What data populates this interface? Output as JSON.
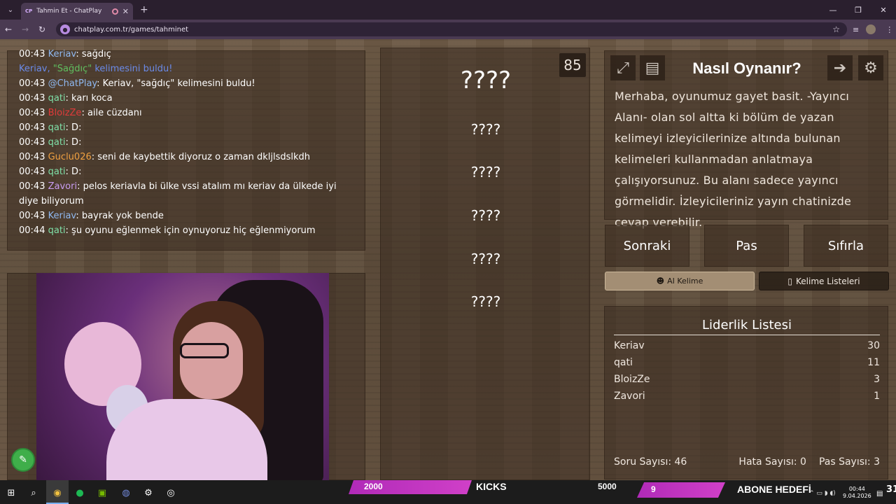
{
  "browser": {
    "tab_title": "Tahmin Et - ChatPlay",
    "tab_favicon": "CP",
    "url": "chatplay.com.tr/games/tahminet"
  },
  "chat": {
    "lines": [
      {
        "time": "00:43",
        "user": "Keriav",
        "color": "blue",
        "text": ": sağdıç"
      },
      {
        "system": true,
        "pre": "Keriav, ",
        "word": "\"Sağdıç\"",
        "post": " kelimesini buldu!"
      },
      {
        "time": "00:43",
        "user": "@ChatPlay",
        "color": "blue",
        "text": ": Keriav, \"sağdıç\" kelimesini buldu!"
      },
      {
        "time": "00:43",
        "user": "qati",
        "color": "green",
        "text": ": karı koca"
      },
      {
        "time": "00:43",
        "user": "BloizZe",
        "color": "red",
        "text": ": aile cüzdanı"
      },
      {
        "time": "00:43",
        "user": "qati",
        "color": "green",
        "text": ": D:"
      },
      {
        "time": "00:43",
        "user": "qati",
        "color": "green",
        "text": ": D:"
      },
      {
        "time": "00:43",
        "user": "Guclu026",
        "color": "orange",
        "text": ": seni de kaybettik diyoruz o zaman dkljlsdslkdh"
      },
      {
        "time": "00:43",
        "user": "qati",
        "color": "green",
        "text": ": D:"
      },
      {
        "time": "00:43",
        "user": "Zavori",
        "color": "purple",
        "text": ": pelos keriavla bi ülke vssi atalım mı keriav da ülkede iyi diye biliyorum"
      },
      {
        "time": "00:43",
        "user": "Keriav",
        "color": "blue",
        "text": ": bayrak yok bende"
      },
      {
        "time": "00:44",
        "user": "qati",
        "color": "green",
        "text": ": şu oyunu eğlenmek için oynuyoruz hiç eğlenmiyorum"
      }
    ]
  },
  "words": {
    "main": "????",
    "list": [
      "????",
      "????",
      "????",
      "????",
      "????"
    ]
  },
  "counter": "85",
  "how": {
    "title": "Nasıl Oynanır?",
    "text": "Merhaba, oyunumuz gayet basit. -Yayıncı Alanı- olan sol altta ki bölüm de yazan kelimeyi izleyicilerinize altında bulunan kelimeleri kullanmadan anlatmaya çalışıyorsunuz. Bu alanı sadece yayıncı görmelidir. İzleyicileriniz yayın chatinizde cevap verebilir."
  },
  "buttons": {
    "next": "Sonraki",
    "pass": "Pas",
    "reset": "Sıfırla",
    "ai_word": "AI Kelime",
    "word_lists": "Kelime Listeleri"
  },
  "leaderboard": {
    "title": "Liderlik Listesi",
    "rows": [
      {
        "name": "Keriav",
        "score": "30"
      },
      {
        "name": "qati",
        "score": "11"
      },
      {
        "name": "BloizZe",
        "score": "3"
      },
      {
        "name": "Zavori",
        "score": "1"
      }
    ],
    "question_count": "Soru Sayısı: 46",
    "error_count": "Hata Sayısı: 0",
    "pass_count": "Pas Sayısı: 3"
  },
  "overlay": {
    "goal1_value": "2000",
    "goal1_label": "KICKS",
    "goal1_target": "5000",
    "goal2_value": "9",
    "goal2_label": "ABONE HEDEFİ"
  },
  "taskbar": {
    "time": "00:44",
    "date": "9.04.2026",
    "day": "31"
  }
}
